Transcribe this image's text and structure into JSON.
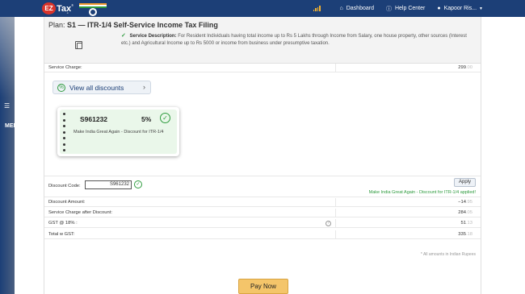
{
  "header": {
    "logo_badge": "EZ",
    "logo_text": "Tax",
    "logo_sup": "®",
    "logo_sub": ".in",
    "nav": [
      {
        "label": "Dashboard",
        "icon": "home-icon"
      },
      {
        "label": "Help Center",
        "icon": "info-icon"
      },
      {
        "label": "Kapoor Ris...",
        "icon": "user-icon"
      }
    ],
    "colors": {
      "bar": "#1c3f77",
      "accent": "#f2b230"
    }
  },
  "sidebar": {
    "menu_label": "MENU"
  },
  "plan": {
    "prefix": "Plan:",
    "title": "S1 — ITR-1/4 Self-Service Income Tax Filing",
    "desc_label": "Service Description:",
    "desc_text": "For Resident Individuals having total income up to Rs 5 Lakhs through Income from Salary, one house property, other sources (Interest etc.) and Agricultural Income up to Rs 5000 or income from business under presumptive taxation."
  },
  "service_charge": {
    "label": "Service Charge:",
    "value": "299",
    "dec": ".00"
  },
  "view_discounts": {
    "label": "View all discounts"
  },
  "coupon": {
    "code": "S961232",
    "percent": "5%",
    "description": "Make India Great Again - Discount for ITR-1/4"
  },
  "discount_code": {
    "label": "Discount Code:",
    "value": "S961232",
    "apply_label": "Apply",
    "applied_msg": "Make India Great Again - Discount for ITR-1/4 applied!"
  },
  "summary": [
    {
      "label": "Discount Amount:",
      "value": "−14",
      "dec": ".95"
    },
    {
      "label": "Service Charge after Discount:",
      "value": "284",
      "dec": ".05"
    },
    {
      "label": "GST @ 18% :",
      "value": "51",
      "dec": ".13"
    },
    {
      "label": "Total w GST:",
      "value": "335",
      "dec": ".18"
    }
  ],
  "note": "* All amounts in Indian Rupees",
  "pay_button": "Pay Now"
}
